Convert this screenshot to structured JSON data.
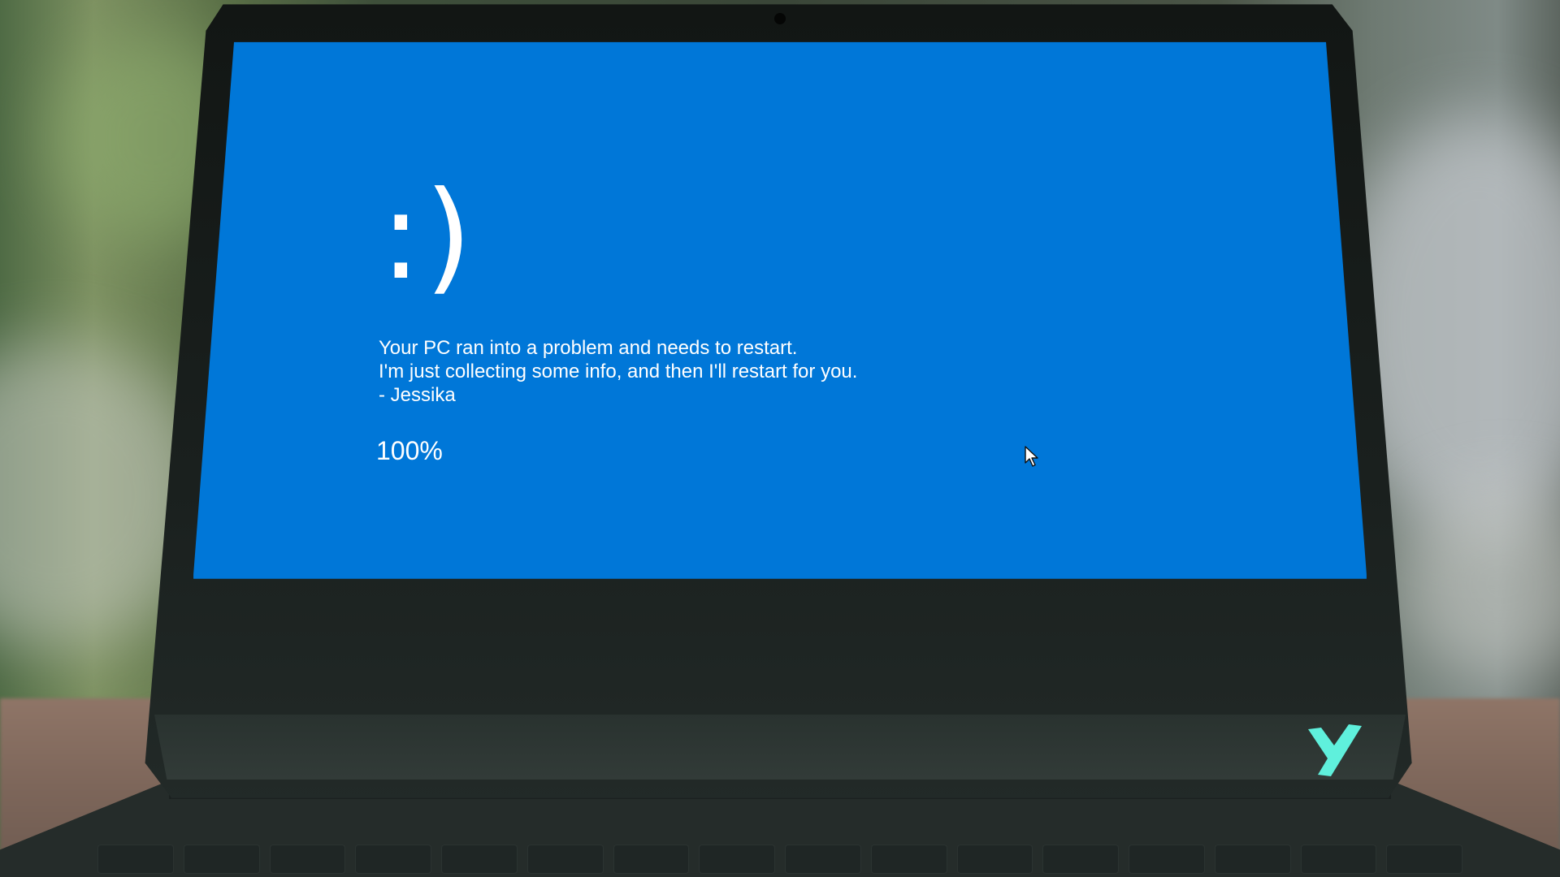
{
  "screen": {
    "emoticon": ":)",
    "message_lines": [
      "Your PC ran into a problem and needs to restart.",
      "I'm just collecting some info, and then I'll restart for you.",
      "- Jessika"
    ],
    "progress_text": "100%"
  },
  "icons": {
    "cursor": "mouse-cursor-icon",
    "logo": "brand-y-logo-icon"
  },
  "colors": {
    "screen_blue": "#0077d8",
    "logo_cyan": "#5ff0dc",
    "text": "#ffffff"
  }
}
